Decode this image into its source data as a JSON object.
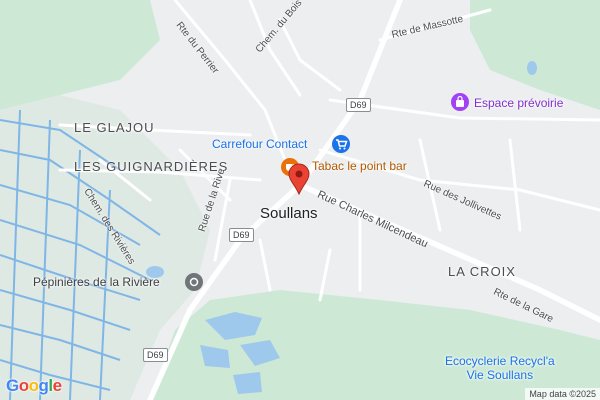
{
  "map": {
    "areas": {
      "le_glajou": "LE GLAJOU",
      "les_guignardieres": "LES GUIGNARDIÈRES",
      "la_croix": "LA CROIX"
    },
    "town": "Soullans",
    "roads": {
      "rte_du_perrier": "Rte du Perrier",
      "chem_du_bois_menard": "Chem. du Bois Ménard",
      "rte_de_massotte": "Rte de Massotte",
      "rue_des_jollivettes": "Rue des Jollivettes",
      "rue_charles_milcendeau": "Rue Charles Milcendeau",
      "rte_de_la_gare": "Rte de la Gare",
      "rue_de_la_rive": "Rue de la Rive",
      "chem_des_rivieres": "Chem. des Rivières"
    },
    "route_shields": [
      "D69",
      "D69",
      "D69"
    ],
    "pois": {
      "carrefour": {
        "label": "Carrefour Contact",
        "icon": "shopping-cart-icon",
        "color": "#1a73e8"
      },
      "tabac": {
        "label": "Tabac le point bar",
        "icon": "cafe-icon",
        "color": "#e8710a"
      },
      "espace": {
        "label": "Espace prévoirie",
        "icon": "shop-bag-icon",
        "color": "#a142f4"
      },
      "pepinieres": {
        "label": "Pépinières de la Rivière",
        "icon": "poi-generic-icon",
        "color": "#70757a"
      },
      "ecocyclerie": {
        "label": "Ecocyclerie Recycl'a Vie Soullans",
        "line1": "Ecocyclerie Recycl'a",
        "line2": "Vie Soullans",
        "color": "#1a73e8"
      }
    },
    "logo": "Google",
    "attribution": "Map data ©2025",
    "colors": {
      "land": "#eceef0",
      "green": "#cde9d6",
      "water": "#9fc8ed",
      "road": "#ffffff",
      "marker": "#ea4335"
    }
  }
}
